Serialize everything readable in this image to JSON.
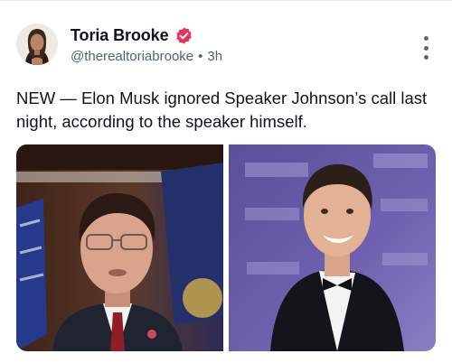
{
  "post": {
    "author": {
      "display_name": "Toria Brooke",
      "handle": "@therealtoriabrooke",
      "verified": true,
      "verified_color": "#e8345d"
    },
    "separator": "•",
    "time_ago": "3h",
    "text": "NEW — Elon Musk ignored Speaker Johnson’s call last night, according to the speaker himself.",
    "icons": {
      "more": "more-vertical-icon",
      "verified": "verified-badge-icon"
    },
    "media": [
      {
        "name": "speaker-johnson-photo"
      },
      {
        "name": "elon-musk-photo"
      }
    ]
  }
}
